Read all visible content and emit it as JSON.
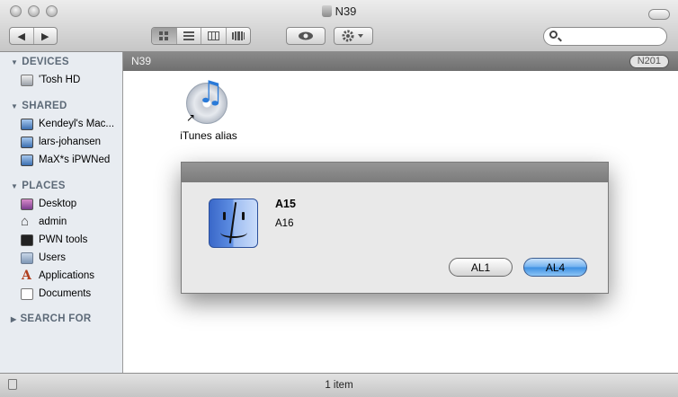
{
  "window": {
    "title": "N39"
  },
  "toolbar": {
    "nav": [
      "◀",
      "▶"
    ],
    "views": [
      "icon-view",
      "list-view",
      "column-view",
      "coverflow-view"
    ],
    "search_placeholder": ""
  },
  "sidebar": {
    "sections": [
      {
        "title": "DEVICES",
        "items": [
          {
            "label": "'Tosh HD",
            "icon": "disk-icon"
          }
        ]
      },
      {
        "title": "SHARED",
        "items": [
          {
            "label": "Kendeyl's Mac...",
            "icon": "computer-icon"
          },
          {
            "label": "lars-johansen",
            "icon": "computer-icon"
          },
          {
            "label": "MaX*s iPWNed",
            "icon": "computer-icon"
          }
        ]
      },
      {
        "title": "PLACES",
        "items": [
          {
            "label": "Desktop",
            "icon": "desktop-icon"
          },
          {
            "label": "admin",
            "icon": "home-icon"
          },
          {
            "label": "PWN tools",
            "icon": "terminal-icon"
          },
          {
            "label": "Users",
            "icon": "users-icon"
          },
          {
            "label": "Applications",
            "icon": "applications-icon"
          },
          {
            "label": "Documents",
            "icon": "documents-icon"
          }
        ]
      },
      {
        "title": "SEARCH FOR",
        "items": []
      }
    ]
  },
  "pathbar": {
    "label": "N39",
    "badge": "N201"
  },
  "content": {
    "files": [
      {
        "name": "iTunes alias",
        "icon": "itunes-alias-icon"
      }
    ]
  },
  "dialog": {
    "title": "A15",
    "message": "A16",
    "buttons": {
      "secondary": "AL1",
      "primary": "AL4"
    }
  },
  "status": {
    "text": "1 item"
  }
}
